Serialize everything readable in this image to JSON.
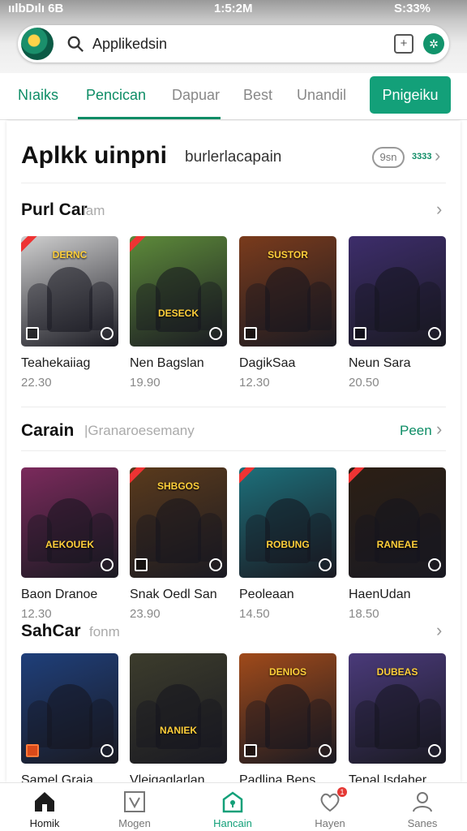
{
  "status": {
    "left": "ıılbDılı 6B",
    "time": "1:5:2M",
    "right": "S:33%"
  },
  "search": {
    "value": "Applikedsin"
  },
  "tabs": [
    {
      "label": "Nıaiks"
    },
    {
      "label": "Pencican"
    },
    {
      "label": "Dapuar"
    },
    {
      "label": "Best"
    },
    {
      "label": "Unandil"
    }
  ],
  "tab_button": "Pnigeiku",
  "panel": {
    "title": "Aplkk uinpni",
    "subtitle": "burlerlacapain",
    "pill": "9sn",
    "pill_num": "3333"
  },
  "sections": [
    {
      "title": "Purl Car",
      "subtitle": "lam",
      "link": "",
      "cards": [
        {
          "name": "Teahekaiiag",
          "price": "22.30",
          "banner": "DERNC",
          "color": "#cfcfcf"
        },
        {
          "name": "Nen Bagslan",
          "price": "19.90",
          "banner": "DESECK",
          "color": "#5d8a3a"
        },
        {
          "name": "DagikSaa",
          "price": "12.30",
          "banner": "SUSTOR",
          "color": "#7a3b1c"
        },
        {
          "name": "Neun Sara",
          "price": "20.50",
          "banner": "",
          "color": "#3d2d6b"
        }
      ]
    },
    {
      "title": "Carain",
      "subtitle": "|Granaroesemany",
      "link": "Peen",
      "cards": [
        {
          "name": "Baon Dranoe",
          "price": "12.30",
          "banner": "AEKOUEK",
          "color": "#7b2a5c"
        },
        {
          "name": "Snak Oedl San",
          "price": "23.90",
          "banner": "SHBGOS",
          "color": "#5a3a1c"
        },
        {
          "name": "Peoleaan",
          "price": "14.50",
          "banner": "ROBUNG",
          "color": "#1d6f7a"
        },
        {
          "name": "HaenUdan",
          "price": "18.50",
          "banner": "RANEAE",
          "color": "#2c1f14"
        }
      ]
    },
    {
      "title": "SahCar",
      "subtitle": "fonm",
      "link": "",
      "cards": [
        {
          "name": "Samel Graia",
          "price": "",
          "banner": "",
          "color": "#1f3f7a"
        },
        {
          "name": "Vleigaglarlan",
          "price": "",
          "banner": "NANIEK",
          "color": "#3c3c2c"
        },
        {
          "name": "Padlina Bens",
          "price": "",
          "banner": "DENIOS",
          "color": "#a04a1a"
        },
        {
          "name": "Tenal Isdaher",
          "price": "",
          "banner": "DUBEAS",
          "color": "#4a3a7a"
        }
      ]
    }
  ],
  "nav": [
    {
      "label": "Homik",
      "icon": "home-icon"
    },
    {
      "label": "Mogen",
      "icon": "vote-icon"
    },
    {
      "label": "Hancain",
      "icon": "store-icon"
    },
    {
      "label": "Hayen",
      "icon": "heart-icon",
      "badge": "1"
    },
    {
      "label": "Sanes",
      "icon": "profile-icon"
    }
  ],
  "colors": {
    "accent": "#13a079",
    "accent_text": "#0e8d66"
  }
}
